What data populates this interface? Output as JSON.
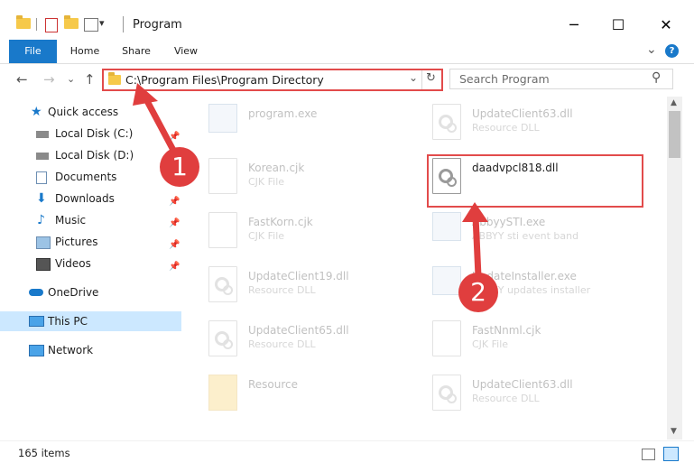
{
  "window": {
    "title": "Program",
    "minimize_glyph": "─",
    "maximize_glyph": "☐",
    "close_glyph": "✕"
  },
  "ribbon": {
    "tabs": [
      "File",
      "Home",
      "Share",
      "View"
    ],
    "expand_glyph": "⌄",
    "help_glyph": "?"
  },
  "nav": {
    "back_glyph": "←",
    "forward_glyph": "→",
    "recent_glyph": "⌄",
    "up_glyph": "↑",
    "address": "C:\\Program Files\\Program Directory",
    "address_dropdown_glyph": "⌄",
    "refresh_glyph": "↻",
    "search_placeholder": "Search Program",
    "search_glyph": "⚲"
  },
  "sidebar": {
    "items": [
      {
        "label": "Quick access",
        "icon": "star-icon",
        "pinned": false
      },
      {
        "label": "Local Disk (C:)",
        "icon": "drive-icon",
        "pinned": true
      },
      {
        "label": "Local Disk (D:)",
        "icon": "drive-icon",
        "pinned": true
      },
      {
        "label": "Documents",
        "icon": "documents-icon",
        "pinned": true
      },
      {
        "label": "Downloads",
        "icon": "downloads-icon",
        "pinned": true
      },
      {
        "label": "Music",
        "icon": "music-icon",
        "pinned": true
      },
      {
        "label": "Pictures",
        "icon": "pictures-icon",
        "pinned": true
      },
      {
        "label": "Videos",
        "icon": "videos-icon",
        "pinned": true
      },
      {
        "label": "OneDrive",
        "icon": "cloud-icon",
        "pinned": false
      },
      {
        "label": "This PC",
        "icon": "computer-icon",
        "pinned": false
      },
      {
        "label": "Network",
        "icon": "network-icon",
        "pinned": false
      }
    ],
    "pin_glyph": "📌"
  },
  "files": [
    {
      "name": "program.exe",
      "type": "",
      "icon": "exe-icon"
    },
    {
      "name": "UpdateClient63.dll",
      "type": "Resource DLL",
      "icon": "dll-icon"
    },
    {
      "name": "Korean.cjk",
      "type": "CJK File",
      "icon": "document-icon"
    },
    {
      "name": "daadvpcl818.dll",
      "type": "",
      "icon": "dll-icon"
    },
    {
      "name": "FastKorn.cjk",
      "type": "CJK File",
      "icon": "document-icon"
    },
    {
      "name": "AbbyySTI.exe",
      "type": "ABBYY sti event band",
      "icon": "exe-icon"
    },
    {
      "name": "UpdateClient19.dll",
      "type": "Resource DLL",
      "icon": "dll-icon"
    },
    {
      "name": "UpdateInstaller.exe",
      "type": "ABBYY updates installer",
      "icon": "exe-icon"
    },
    {
      "name": "UpdateClient65.dll",
      "type": "Resource DLL",
      "icon": "dll-icon"
    },
    {
      "name": "FastNnml.cjk",
      "type": "CJK File",
      "icon": "document-icon"
    },
    {
      "name": "Resource",
      "type": "",
      "icon": "folder-icon"
    },
    {
      "name": "UpdateClient63.dll",
      "type": "Resource DLL",
      "icon": "dll-icon"
    }
  ],
  "status": {
    "item_count": "165 items"
  },
  "annotations": {
    "step1": "1",
    "step2": "2",
    "color": "#e03e3e"
  }
}
